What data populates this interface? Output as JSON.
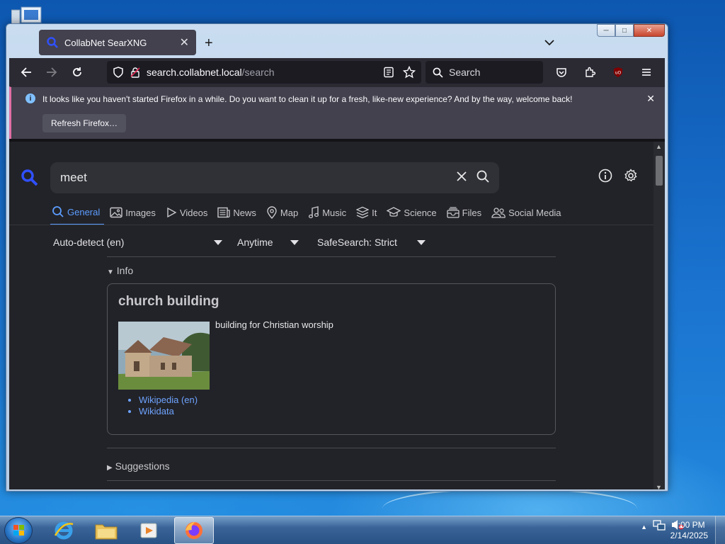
{
  "browser": {
    "tab_title": "CollabNet SearXNG",
    "url_host": "search.collabnet.local",
    "url_path": "/search",
    "search_placeholder": "Search"
  },
  "notification": {
    "message": "It looks like you haven't started Firefox in a while. Do you want to clean it up for a fresh, like-new experience? And by the way, welcome back!",
    "button": "Refresh Firefox…"
  },
  "searxng": {
    "query": "meet",
    "categories": [
      {
        "label": "General",
        "icon": "search-icon",
        "active": true
      },
      {
        "label": "Images",
        "icon": "image-icon"
      },
      {
        "label": "Videos",
        "icon": "play-icon"
      },
      {
        "label": "News",
        "icon": "newspaper-icon"
      },
      {
        "label": "Map",
        "icon": "map-pin-icon"
      },
      {
        "label": "Music",
        "icon": "music-note-icon"
      },
      {
        "label": "It",
        "icon": "layers-icon"
      },
      {
        "label": "Science",
        "icon": "school-icon"
      },
      {
        "label": "Files",
        "icon": "file-tray-icon"
      },
      {
        "label": "Social Media",
        "icon": "people-icon"
      }
    ],
    "filters": {
      "language": "Auto-detect (en)",
      "time": "Anytime",
      "safesearch": "SafeSearch: Strict"
    },
    "info_heading": "Info",
    "infobox": {
      "title": "church building",
      "description": "building for Christian worship",
      "links": [
        "Wikipedia (en)",
        "Wikidata"
      ]
    },
    "suggestions_heading": "Suggestions"
  },
  "taskbar": {
    "time": "3:00 PM",
    "date": "2/14/2025"
  },
  "colors": {
    "accent": "#5c9dff",
    "link": "#6ea3ff",
    "page_bg": "#222328",
    "toolbar_bg": "#2b2a33"
  }
}
